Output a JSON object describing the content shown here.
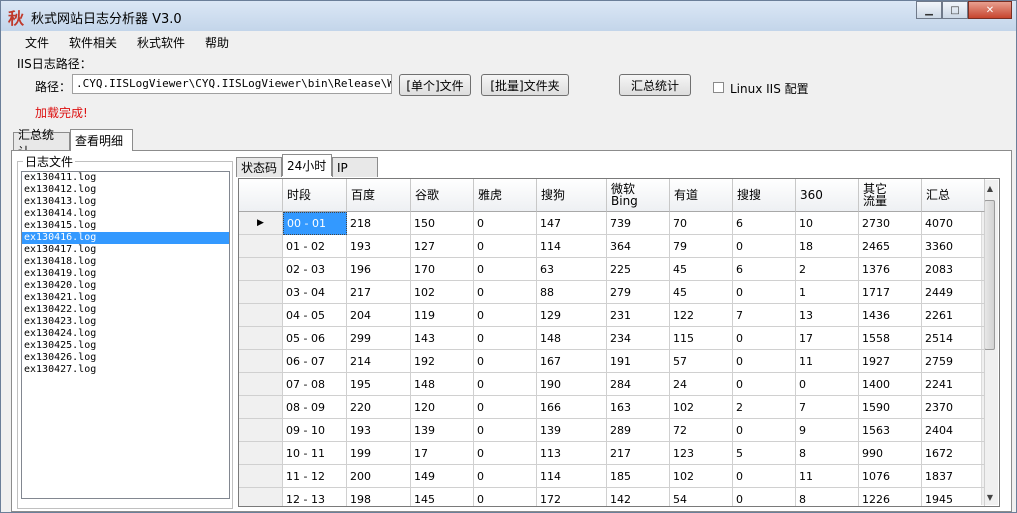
{
  "window": {
    "title": "秋式网站日志分析器 V3.0",
    "icon_glyph": "秋"
  },
  "menu": [
    "文件",
    "软件相关",
    "秋式软件",
    "帮助"
  ],
  "iis": {
    "section_label": "IIS日志路径：",
    "path_label": "路径：",
    "path_value": ".CYQ.IISLogViewer\\CYQ.IISLogViewer\\bin\\Release\\W3SVC1",
    "single_file_button": "[单个]文件",
    "batch_folder_button": "[批量]文件夹",
    "summary_button": "汇总统计",
    "linux_label": "Linux IIS 配置",
    "status": "加载完成!"
  },
  "main_tabs": [
    "汇总统计",
    "查看明细"
  ],
  "log_files": {
    "title": "日志文件",
    "items": [
      "ex130411.log",
      "ex130412.log",
      "ex130413.log",
      "ex130414.log",
      "ex130415.log",
      "ex130416.log",
      "ex130417.log",
      "ex130418.log",
      "ex130419.log",
      "ex130420.log",
      "ex130421.log",
      "ex130422.log",
      "ex130423.log",
      "ex130424.log",
      "ex130425.log",
      "ex130426.log",
      "ex130427.log"
    ],
    "selected_index": 5
  },
  "sub_tabs": [
    "状态码",
    "24小时",
    "IP"
  ],
  "grid": {
    "headers": [
      "时段",
      "百度",
      "谷歌",
      "雅虎",
      "搜狗",
      "微软\nBing",
      "有道",
      "搜搜",
      "360",
      "其它\n流量",
      "汇总"
    ],
    "rows": [
      [
        "00 - 01",
        "218",
        "150",
        "0",
        "147",
        "739",
        "70",
        "6",
        "10",
        "2730",
        "4070"
      ],
      [
        "01 - 02",
        "193",
        "127",
        "0",
        "114",
        "364",
        "79",
        "0",
        "18",
        "2465",
        "3360"
      ],
      [
        "02 - 03",
        "196",
        "170",
        "0",
        "63",
        "225",
        "45",
        "6",
        "2",
        "1376",
        "2083"
      ],
      [
        "03 - 04",
        "217",
        "102",
        "0",
        "88",
        "279",
        "45",
        "0",
        "1",
        "1717",
        "2449"
      ],
      [
        "04 - 05",
        "204",
        "119",
        "0",
        "129",
        "231",
        "122",
        "7",
        "13",
        "1436",
        "2261"
      ],
      [
        "05 - 06",
        "299",
        "143",
        "0",
        "148",
        "234",
        "115",
        "0",
        "17",
        "1558",
        "2514"
      ],
      [
        "06 - 07",
        "214",
        "192",
        "0",
        "167",
        "191",
        "57",
        "0",
        "11",
        "1927",
        "2759"
      ],
      [
        "07 - 08",
        "195",
        "148",
        "0",
        "190",
        "284",
        "24",
        "0",
        "0",
        "1400",
        "2241"
      ],
      [
        "08 - 09",
        "220",
        "120",
        "0",
        "166",
        "163",
        "102",
        "2",
        "7",
        "1590",
        "2370"
      ],
      [
        "09 - 10",
        "193",
        "139",
        "0",
        "139",
        "289",
        "72",
        "0",
        "9",
        "1563",
        "2404"
      ],
      [
        "10 - 11",
        "199",
        "17",
        "0",
        "113",
        "217",
        "123",
        "5",
        "8",
        "990",
        "1672"
      ],
      [
        "11 - 12",
        "200",
        "149",
        "0",
        "114",
        "185",
        "102",
        "0",
        "11",
        "1076",
        "1837"
      ],
      [
        "12 - 13",
        "198",
        "145",
        "0",
        "172",
        "142",
        "54",
        "0",
        "8",
        "1226",
        "1945"
      ]
    ],
    "current_row_marker": "▶"
  }
}
